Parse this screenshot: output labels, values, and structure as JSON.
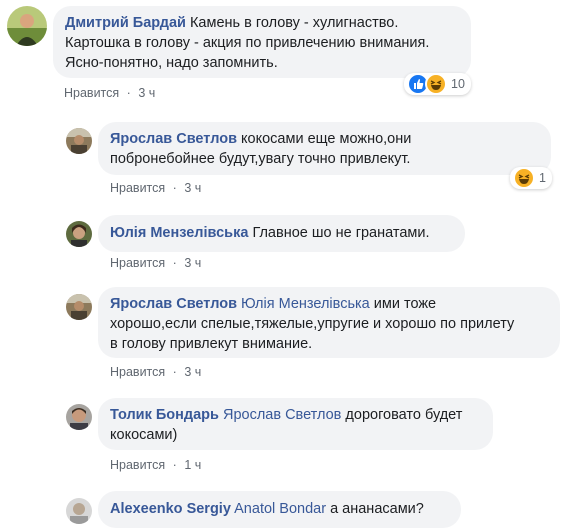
{
  "comments": [
    {
      "author": "Дмитрий Бардай",
      "mention": "",
      "lines": [
        "Камень в голову - хулигнаство.",
        "Картошка в голову - акция по привлечению внимания.",
        "Ясно-понятно, надо запомнить."
      ],
      "like_label": "Нравится",
      "time": "3 ч",
      "reaction_count": "10",
      "reactions": [
        "like-icon",
        "haha-icon"
      ]
    },
    {
      "author": "Ярослав Светлов",
      "mention": "",
      "lines": [
        "кокосами еще можно,они",
        "побронебойнее будут,увагу точно привлекут."
      ],
      "like_label": "Нравится",
      "time": "3 ч",
      "reaction_count": "1",
      "reactions": [
        "haha-icon"
      ]
    },
    {
      "author": "Юлія Мензелівська",
      "mention": "",
      "lines": [
        "Главное шо не гранатами."
      ],
      "like_label": "Нравится",
      "time": "3 ч"
    },
    {
      "author": "Ярослав Светлов",
      "mention": "Юлія Мензелівська",
      "lines": [
        "ими тоже",
        "хорошо,если спелые,тяжелые,упругие и хорошо по прилету",
        "в голову привлекут внимание."
      ],
      "like_label": "Нравится",
      "time": "3 ч"
    },
    {
      "author": "Толик Бондарь",
      "mention": "Ярослав Светлов",
      "lines": [
        "дороговато будет",
        "кокосами)"
      ],
      "like_label": "Нравится",
      "time": "1 ч"
    },
    {
      "author": "Alexeenko Sergiy",
      "mention": "Anatol Bondar",
      "lines": [
        "а ананасами?"
      ]
    }
  ],
  "separator": "·"
}
